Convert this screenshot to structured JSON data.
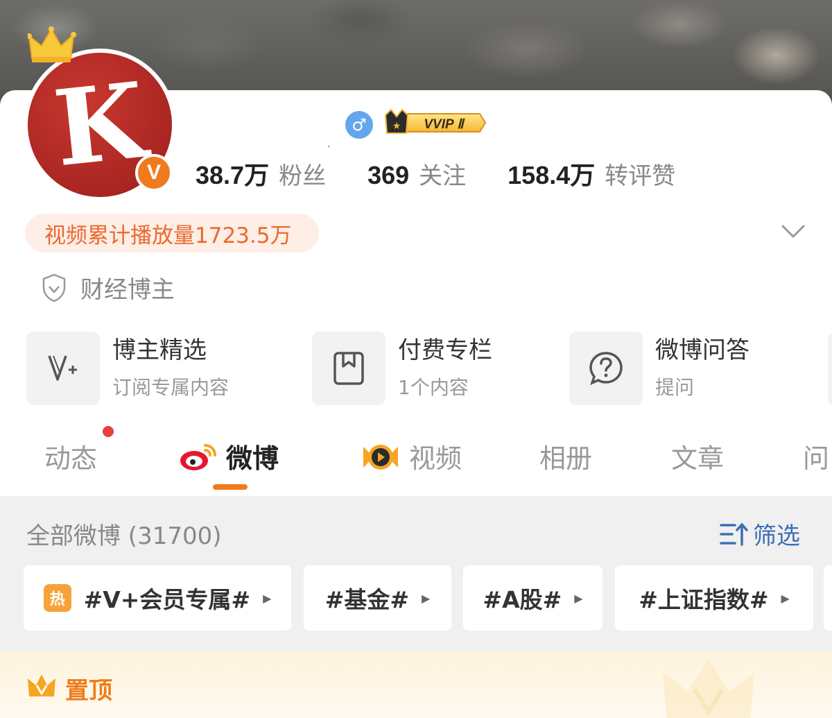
{
  "profile": {
    "avatar_letter": "K",
    "verified_badge": "V",
    "name_mark": ".",
    "gender_symbol": "♂",
    "vip_badge_text": "VVIP Ⅱ",
    "stats": [
      {
        "value": "38.7万",
        "label": "粉丝"
      },
      {
        "value": "369",
        "label": "关注"
      },
      {
        "value": "158.4万",
        "label": "转评赞"
      }
    ],
    "play_count": "视频累计播放量1723.5万",
    "verification": "财经博主"
  },
  "features": [
    {
      "title": "博主精选",
      "subtitle": "订阅专属内容",
      "icon": "v-plus-icon"
    },
    {
      "title": "付费专栏",
      "subtitle": "1个内容",
      "icon": "bookmark-icon"
    },
    {
      "title": "微博问答",
      "subtitle": "提问",
      "icon": "question-icon"
    }
  ],
  "tabs": [
    {
      "label": "动态",
      "has_dot": true
    },
    {
      "label": "微博",
      "active": true,
      "icon": "weibo-icon"
    },
    {
      "label": "视频",
      "icon": "video-play-icon"
    },
    {
      "label": "相册"
    },
    {
      "label": "文章"
    },
    {
      "label": "问"
    }
  ],
  "feed": {
    "all_title": "全部微博 (31700)",
    "filter_label": "筛选",
    "topics": [
      {
        "label": "#V+会员专属#",
        "hot": true,
        "hot_text": "热"
      },
      {
        "label": "#基金#"
      },
      {
        "label": "#A股#"
      },
      {
        "label": "#上证指数#"
      }
    ]
  },
  "pinned": {
    "label": "置顶"
  },
  "colors": {
    "accent_orange": "#f07b1f",
    "link_blue": "#3b6fb5",
    "avatar_red": "#b52a24",
    "notification_red": "#e8413c"
  }
}
